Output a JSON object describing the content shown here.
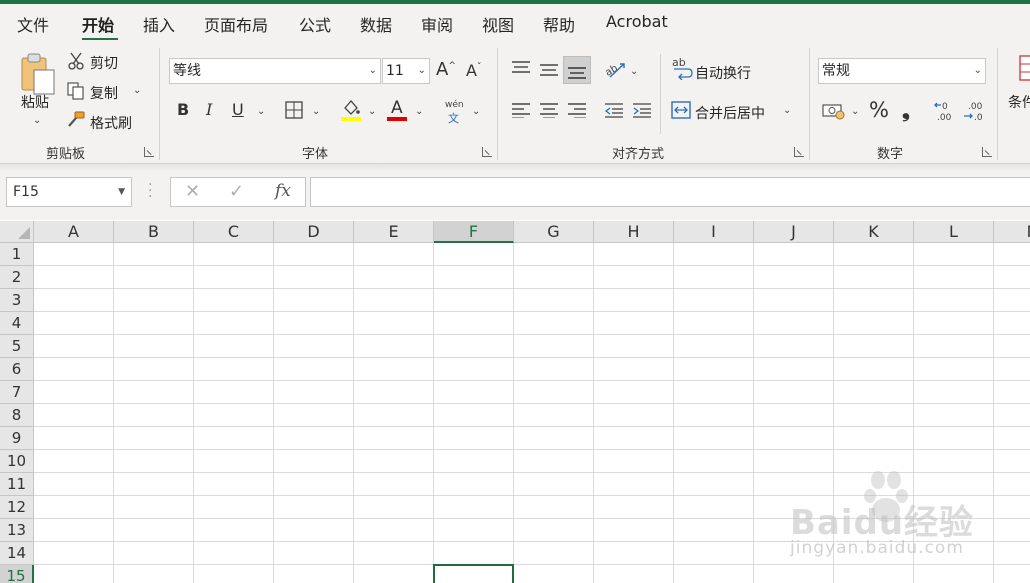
{
  "menu": {
    "tabs": [
      {
        "label": "文件"
      },
      {
        "label": "开始"
      },
      {
        "label": "插入"
      },
      {
        "label": "页面布局"
      },
      {
        "label": "公式"
      },
      {
        "label": "数据"
      },
      {
        "label": "审阅"
      },
      {
        "label": "视图"
      },
      {
        "label": "帮助"
      },
      {
        "label": "Acrobat"
      }
    ],
    "active_index": 1
  },
  "ribbon": {
    "clipboard": {
      "paste_label": "粘贴",
      "cut_label": "剪切",
      "copy_label": "复制",
      "format_painter_label": "格式刷",
      "group_label": "剪贴板"
    },
    "font": {
      "font_name": "等线",
      "font_size": "11",
      "bold": "B",
      "italic": "I",
      "underline": "U",
      "font_color_letter": "A",
      "phonetic_top": "wén",
      "phonetic_bottom": "文",
      "grow_letter": "A",
      "shrink_letter": "A",
      "group_label": "字体",
      "fill_color": "#ffff00",
      "text_color": "#e00000"
    },
    "alignment": {
      "wrap_text_label": "自动换行",
      "merge_center_label": "合并后居中",
      "wrap_prefix": "ab",
      "group_label": "对齐方式"
    },
    "number": {
      "format_value": "常规",
      "percent": "%",
      "comma": "❟",
      "group_label": "数字"
    },
    "styles": {
      "conditional_label": "条件"
    }
  },
  "formula_bar": {
    "name_box": "F15",
    "cancel_icon": "✕",
    "enter_icon": "✓",
    "fx_label": "fx",
    "formula_value": ""
  },
  "sheet": {
    "columns": [
      "A",
      "B",
      "C",
      "D",
      "E",
      "F",
      "G",
      "H",
      "I",
      "J",
      "K",
      "L",
      "M"
    ],
    "rows": [
      "1",
      "2",
      "3",
      "4",
      "5",
      "6",
      "7",
      "8",
      "9",
      "10",
      "11",
      "12",
      "13",
      "14",
      "15"
    ],
    "selected_column": "F",
    "selected_row": "15",
    "accent_color": "#217346"
  },
  "watermark": {
    "brand": "Bai",
    "brand_suffix": "du经验",
    "url": "jingyan.baidu.com"
  }
}
